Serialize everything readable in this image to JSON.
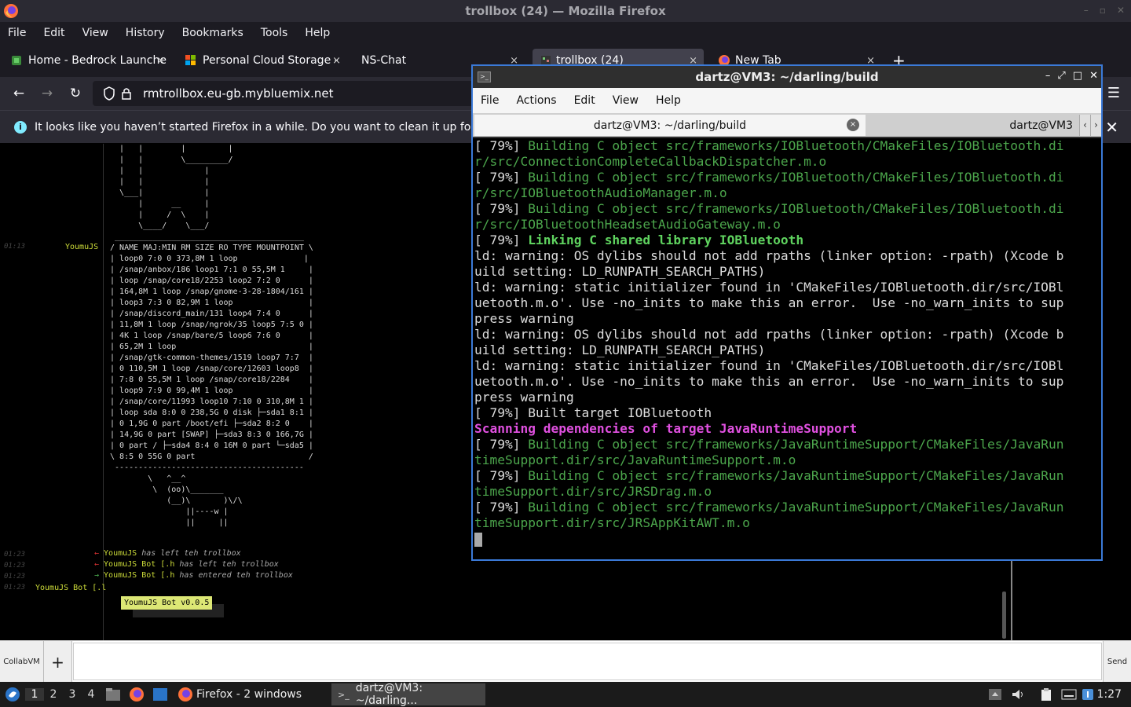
{
  "firefox": {
    "window_title": "trollbox (24) — Mozilla Firefox",
    "menu": [
      "File",
      "Edit",
      "View",
      "History",
      "Bookmarks",
      "Tools",
      "Help"
    ],
    "tabs": [
      {
        "label": "Home - Bedrock Launche",
        "close": "×"
      },
      {
        "label": "Personal Cloud Storage -",
        "close": "×"
      },
      {
        "label": "NS-Chat",
        "close": "×"
      },
      {
        "label": "trollbox (24)",
        "close": "×"
      },
      {
        "label": "New Tab",
        "close": "×"
      }
    ],
    "new_tab": "+",
    "url": "rmtrollbox.eu-gb.mybluemix.net",
    "notification": "It looks like you haven’t started Firefox in a while. Do you want to clean it up for a f",
    "notification_close": "✕"
  },
  "chat": {
    "ascii_art": "   |   |        |         |\n   |   |        \\_________/\n   |   |             |\n   |   |             |\n   \\___|             |\n       |      __     |\n       |     /  \\    |\n       \\____/    \\___/\n  ________________________________________\n / NAME MAJ:MIN RM SIZE RO TYPE MOUNTPOINT \\\n | loop0 7:0 0 373,8M 1 loop              |\n | /snap/anbox/186 loop1 7:1 0 55,5M 1     |\n | loop /snap/core18/2253 loop2 7:2 0      |\n | 164,8M 1 loop /snap/gnome-3-28-1804/161 |\n | loop3 7:3 0 82,9M 1 loop                |\n | /snap/discord_main/131 loop4 7:4 0      |\n | 11,8M 1 loop /snap/ngrok/35 loop5 7:5 0 |\n | 4K 1 loop /snap/bare/5 loop6 7:6 0      |\n | 65,2M 1 loop                            |\n | /snap/gtk-common-themes/1519 loop7 7:7  |\n | 0 110,5M 1 loop /snap/core/12603 loop8  |\n | 7:8 0 55,5M 1 loop /snap/core18/2284    |\n | loop9 7:9 0 99,4M 1 loop                |\n | /snap/core/11993 loop10 7:10 0 310,8M 1 |\n | loop sda 8:0 0 238,5G 0 disk ├─sda1 8:1 |\n | 0 1,9G 0 part /boot/efi ├─sda2 8:2 0    |\n | 14,9G 0 part [SWAP] ├─sda3 8:3 0 166,7G |\n | 0 part / ├─sda4 8:4 0 16M 0 part └─sda5 |\n \\ 8:5 0 55G 0 part                        /\n  ----------------------------------------\n         \\   ^__^\n          \\  (oo)\\_______\n             (__)\\       )\\/\\\n                 ||----w |\n                 ||     ||",
    "ts_0113": "01:13",
    "nick_youmu": "YoumuJS",
    "events": [
      {
        "ts": "01:23",
        "arrow": "←",
        "user": "YoumuJS",
        "text": "has left teh trollbox"
      },
      {
        "ts": "01:23",
        "arrow": "←",
        "user": "YoumuJS Bot [.h",
        "text": "has left teh trollbox"
      },
      {
        "ts": "01:23",
        "arrow": "→",
        "user": "YoumuJS Bot [.h",
        "text": "has entered teh trollbox"
      }
    ],
    "ts_last": "01:23",
    "nick_bot": "YoumuJS Bot [.l",
    "bot_badge": "YoumuJS Bot v0.0.5",
    "collab_btn": "CollabVM",
    "plus_btn": "+",
    "send_btn": "Send"
  },
  "terminal": {
    "title": "dartz@VM3: ~/darling/build",
    "menu": [
      "File",
      "Actions",
      "Edit",
      "View",
      "Help"
    ],
    "tab1": "dartz@VM3: ~/darling/build",
    "tab1_close": "×",
    "tab2": "dartz@VM3",
    "tab_left": "‹",
    "tab_right": "›",
    "lines": [
      {
        "p": "[ 79%] ",
        "t": "Building C object src/frameworks/IOBluetooth/CMakeFiles/IOBluetooth.di",
        "c": "g"
      },
      {
        "p": "",
        "t": "r/src/ConnectionCompleteCallbackDispatcher.m.o",
        "c": "g"
      },
      {
        "p": "[ 79%] ",
        "t": "Building C object src/frameworks/IOBluetooth/CMakeFiles/IOBluetooth.di",
        "c": "g"
      },
      {
        "p": "",
        "t": "r/src/IOBluetoothAudioManager.m.o",
        "c": "g"
      },
      {
        "p": "[ 79%] ",
        "t": "Building C object src/frameworks/IOBluetooth/CMakeFiles/IOBluetooth.di",
        "c": "g"
      },
      {
        "p": "",
        "t": "r/src/IOBluetoothHeadsetAudioGateway.m.o",
        "c": "g"
      },
      {
        "p": "[ 79%] ",
        "t": "Linking C shared library IOBluetooth",
        "c": "gb"
      },
      {
        "p": "",
        "t": "ld: warning: OS dylibs should not add rpaths (linker option: -rpath) (Xcode b",
        "c": "w"
      },
      {
        "p": "",
        "t": "uild setting: LD_RUNPATH_SEARCH_PATHS)",
        "c": "w"
      },
      {
        "p": "",
        "t": "ld: warning: static initializer found in 'CMakeFiles/IOBluetooth.dir/src/IOBl",
        "c": "w"
      },
      {
        "p": "",
        "t": "uetooth.m.o'. Use -no_inits to make this an error.  Use -no_warn_inits to sup",
        "c": "w"
      },
      {
        "p": "",
        "t": "press warning",
        "c": "w"
      },
      {
        "p": "",
        "t": "ld: warning: OS dylibs should not add rpaths (linker option: -rpath) (Xcode b",
        "c": "w"
      },
      {
        "p": "",
        "t": "uild setting: LD_RUNPATH_SEARCH_PATHS)",
        "c": "w"
      },
      {
        "p": "",
        "t": "ld: warning: static initializer found in 'CMakeFiles/IOBluetooth.dir/src/IOBl",
        "c": "w"
      },
      {
        "p": "",
        "t": "uetooth.m.o'. Use -no_inits to make this an error.  Use -no_warn_inits to sup",
        "c": "w"
      },
      {
        "p": "",
        "t": "press warning",
        "c": "w"
      },
      {
        "p": "",
        "t": "[ 79%] Built target IOBluetooth",
        "c": "w"
      },
      {
        "p": "",
        "t": "Scanning dependencies of target JavaRuntimeSupport",
        "c": "m"
      },
      {
        "p": "[ 79%] ",
        "t": "Building C object src/frameworks/JavaRuntimeSupport/CMakeFiles/JavaRun",
        "c": "g"
      },
      {
        "p": "",
        "t": "timeSupport.dir/src/JavaRuntimeSupport.m.o",
        "c": "g"
      },
      {
        "p": "[ 79%] ",
        "t": "Building C object src/frameworks/JavaRuntimeSupport/CMakeFiles/JavaRun",
        "c": "g"
      },
      {
        "p": "",
        "t": "timeSupport.dir/src/JRSDrag.m.o",
        "c": "g"
      },
      {
        "p": "[ 79%] ",
        "t": "Building C object src/frameworks/JavaRuntimeSupport/CMakeFiles/JavaRun",
        "c": "g"
      },
      {
        "p": "",
        "t": "timeSupport.dir/src/JRSAppKitAWT.m.o",
        "c": "g"
      }
    ]
  },
  "taskbar": {
    "workspaces": [
      "1",
      "2",
      "3",
      "4"
    ],
    "task_firefox": "Firefox - 2 windows",
    "task_terminal": "dartz@VM3: ~/darling...",
    "clock": "1:27"
  }
}
